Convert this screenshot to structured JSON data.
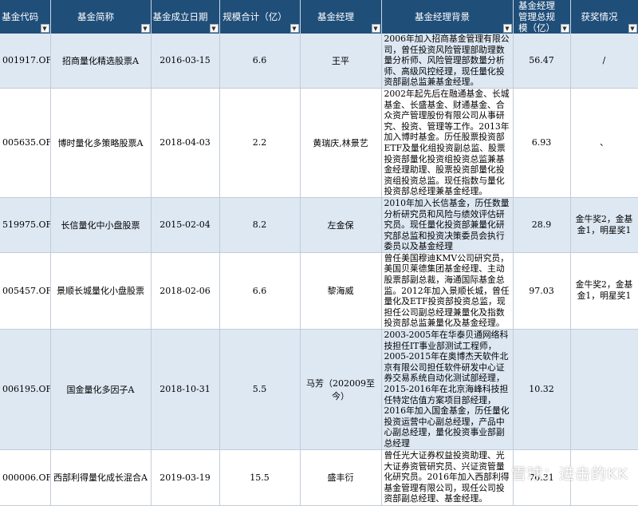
{
  "table": {
    "headers": [
      "基金代码",
      "基金简称",
      "基金成立日期",
      "规模合计（亿）",
      "基金经理",
      "基金经理背景",
      "基金经理管理总规模（亿）",
      "获奖情况"
    ],
    "dropdown_icon": "▼",
    "rows": [
      {
        "code": "001917.OF",
        "name": "招商量化精选股票A",
        "date": "2016-03-15",
        "size": "6.6",
        "manager": "王平",
        "background": "2006年加入招商基金管理有限公司，曾任投资风险管理部助理数量分析师、风险管理部数量分析师、高级风控经理，现任量化投资部副总监兼基金经理。",
        "total": "56.47",
        "awards": "/"
      },
      {
        "code": "005635.OF",
        "name": "博时量化多策略股票A",
        "date": "2018-04-03",
        "size": "2.2",
        "manager": "黄瑞庆,林景艺",
        "background": "2002年起先后在融通基金、长城基金、长盛基金、财通基金、合众资产管理股份有限公司从事研究、投资、管理等工作。2013年加入博时基金。历任股票投资部ETF及量化组投资副总监、股票投资部量化投资组投资总监兼基金经理助理、股票投资部量化投资组投资总监。现任指数与量化投资部总经理兼基金经理。",
        "total": "6.93",
        "awards": "、"
      },
      {
        "code": "519975.OF",
        "name": "长信量化中小盘股票",
        "date": "2015-02-04",
        "size": "8.2",
        "manager": "左金保",
        "background": "2010年加入长信基金，历任数量分析研究员和风险与绩效评估研究员。现任量化投资部兼量化研究部总监和投资决策委员会执行委员以及基金经理",
        "total": "28.9",
        "awards": "金牛奖2，金基金1，明星奖1"
      },
      {
        "code": "005457.OF",
        "name": "景顺长城量化小盘股票",
        "date": "2018-02-06",
        "size": "6.6",
        "manager": "黎海威",
        "background": "曾任美国穆迪KMV公司研究员，美国贝莱德集团基金经理、主动股票部副总裁，海通国际基金总监。2012年加入景顺长城，曾任量化及ETF投资部投资总监，现担任公司副总经理兼量化及指数投资部总监兼量化及基金经理。",
        "total": "97.03",
        "awards": "金牛奖2，金基金1，明星奖1"
      },
      {
        "code": "006195.OF",
        "name": "国金量化多因子A",
        "date": "2018-10-31",
        "size": "5.5",
        "manager": "马芳（202009至今）",
        "background": "2003-2005年在华泰贝通网络科技担任IT事业部测试工程师，2005-2015年在奥博杰天软件北京有限公司担任软件研发中心证券交易系统自动化测试部经理，2015-2016年在北京海峰科技担任特定估值方案项目部经理，2016年加入国金基金，历任量化投资运营中心副总经理，产品中心副总经理，量化投资事业部副总经理",
        "total": "10.32",
        "awards": ""
      },
      {
        "code": "000006.OF",
        "name": "西部利得量化成长混合A",
        "date": "2019-03-19",
        "size": "15.5",
        "manager": "盛丰衍",
        "background": "曾任光大证券权益投资助理、光大证券资管研究员、兴证资管量化研究员。2016年加入西部利得基金管理有限公司，现任公司投资部副总经理、基金经理。",
        "total": "70.31",
        "awards": ""
      }
    ]
  },
  "watermark": "雪球：进击的KK"
}
